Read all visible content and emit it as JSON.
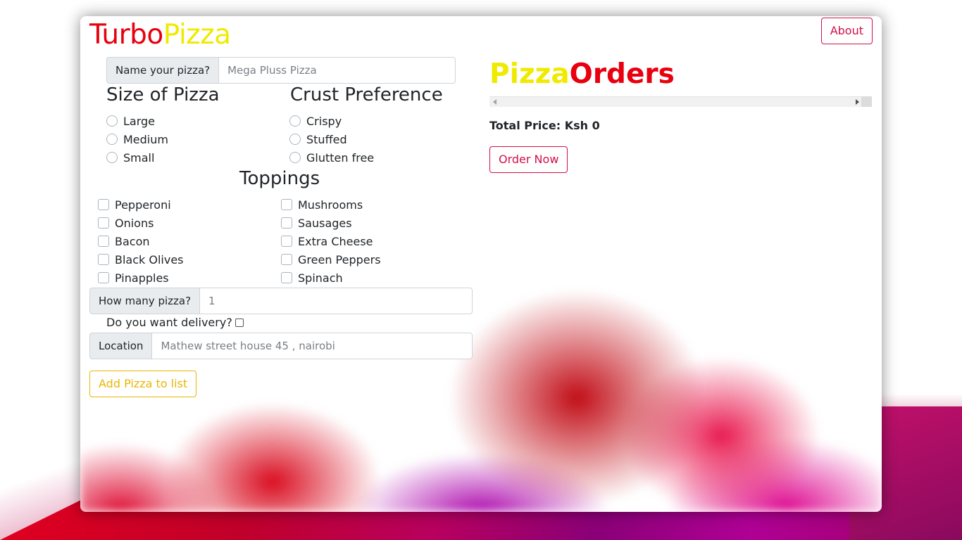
{
  "brand": {
    "part1": "Turbo",
    "part2": "Pizza"
  },
  "nav": {
    "about_label": "About"
  },
  "form": {
    "name_label": "Name your pizza?",
    "name_placeholder": "Mega Pluss Pizza",
    "size_title": "Size of Pizza",
    "sizes": [
      "Large",
      "Medium",
      "Small"
    ],
    "crust_title": "Crust Preference",
    "crusts": [
      "Crispy",
      "Stuffed",
      "Glutten free"
    ],
    "toppings_title": "Toppings",
    "toppings_left": [
      "Pepperoni",
      "Onions",
      "Bacon",
      "Black Olives",
      "Pinapples"
    ],
    "toppings_right": [
      "Mushrooms",
      "Sausages",
      "Extra Cheese",
      "Green Peppers",
      "Spinach"
    ],
    "quantity_label": "How many pizza?",
    "quantity_placeholder": "1",
    "delivery_label": "Do you want delivery?",
    "location_label": "Location",
    "location_placeholder": "Mathew street house 45 , nairobi",
    "add_button": "Add Pizza to list"
  },
  "orders": {
    "title_part1": "Pizza",
    "title_part2": "Orders",
    "total_label": "Total Price: Ksh 0",
    "order_button": "Order Now"
  },
  "colors": {
    "brand_red": "#e8000f",
    "brand_yellow": "#f0ea00",
    "accent_pink": "#d1104a",
    "accent_gold": "#e9b600"
  }
}
